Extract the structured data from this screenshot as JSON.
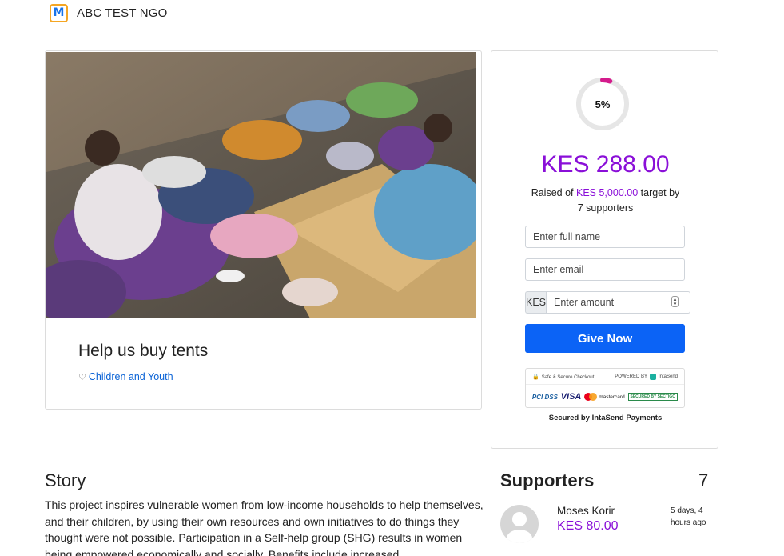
{
  "header": {
    "logo_letter": "M",
    "org_name": "ABC TEST NGO"
  },
  "campaign": {
    "title": "Help us buy tents",
    "category": "Children and Youth",
    "photo_description_icon": "campaign-photo"
  },
  "donation": {
    "progress_percent": 5,
    "progress_label": "5%",
    "raised": "KES 288.00",
    "raised_prefix": "Raised of",
    "target": "KES 5,000.00",
    "target_suffix": "target by",
    "supporters_text": "7 supporters",
    "name_placeholder": "Enter full name",
    "email_placeholder": "Enter email",
    "currency": "KES",
    "amount_placeholder": "Enter amount",
    "give_button": "Give Now",
    "secure_checkout": "Safe & Secure Checkout",
    "powered_by": "POWERED BY",
    "powered_brand": "IntaSend",
    "pci_label": "PCI DSS",
    "visa_label": "VISA",
    "mastercard_label": "mastercard",
    "sectigo_label": "SECURED BY SECTIGO",
    "secured_by": "Secured by IntaSend Payments",
    "accent_color": "#8a0fd8",
    "button_color": "#0b63f6"
  },
  "story": {
    "heading": "Story",
    "text": "This project inspires vulnerable women from low-income households to help themselves, and their children, by using their own resources and own initiatives to do things they thought were not possible. Participation in a Self-help group (SHG) results in women being empowered economically and socially. Benefits include increased"
  },
  "supporters": {
    "heading": "Supporters",
    "count": "7",
    "items": [
      {
        "name": "Moses Korir",
        "amount": "KES 80.00",
        "time": "5 days, 4 hours ago"
      }
    ]
  }
}
